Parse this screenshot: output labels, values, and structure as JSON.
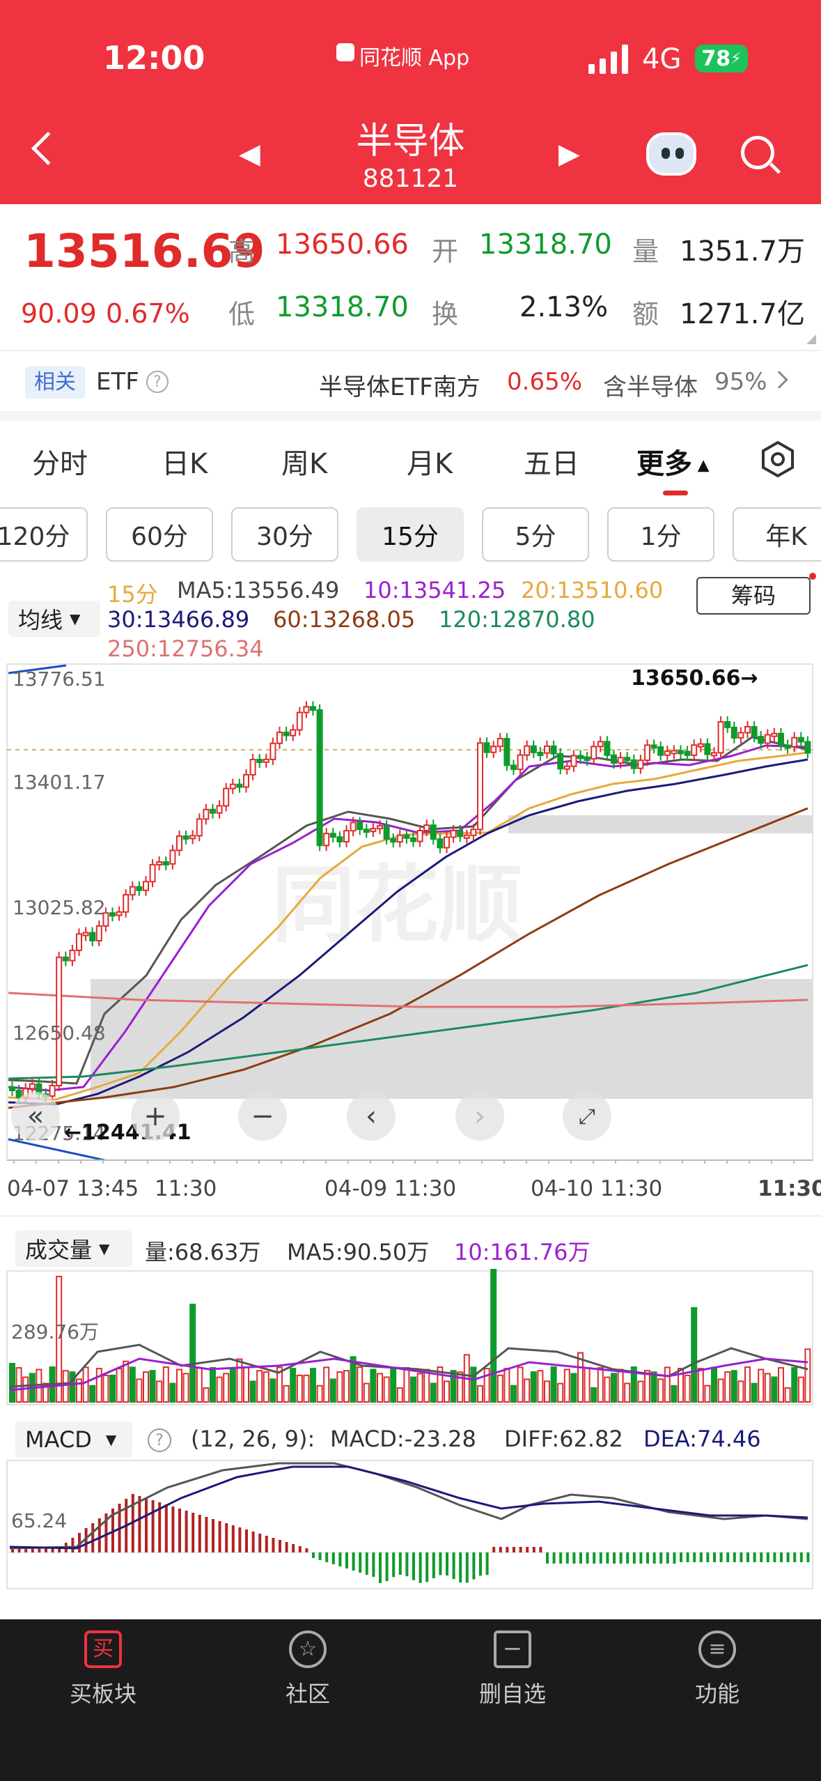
{
  "status_bar": {
    "time": "12:00",
    "app": "同花顺 App",
    "network": "4G",
    "battery": "78"
  },
  "header": {
    "title": "半导体",
    "code": "881121",
    "prev": "◀",
    "next": "▶"
  },
  "quote": {
    "price": "13516.69",
    "change": "90.09",
    "change_pct": "0.67%",
    "high_label": "高",
    "high": "13650.66",
    "open_label": "开",
    "open": "13318.70",
    "vol_label": "量",
    "vol": "1351.7万",
    "low_label": "低",
    "low": "13318.70",
    "turn_label": "换",
    "turn": "2.13%",
    "amt_label": "额",
    "amt": "1271.7亿"
  },
  "etf": {
    "tag": "相关",
    "label": "ETF",
    "name": "半导体ETF南方",
    "pct": "0.65%",
    "hold": "含半导体",
    "hold_pct": "95%"
  },
  "tabs": [
    "分时",
    "日K",
    "周K",
    "月K",
    "五日",
    "更多"
  ],
  "periods": [
    "120分",
    "60分",
    "30分",
    "15分",
    "5分",
    "1分",
    "年K"
  ],
  "ma": {
    "selector": "均线",
    "period": "15分",
    "ma5": "MA5:13556.49",
    "ma10": "10:13541.25",
    "ma20": "20:13510.60",
    "ma30": "30:13466.89",
    "ma60": "60:13268.05",
    "ma120": "120:12870.80",
    "ma250": "250:12756.34",
    "chip": "筹码"
  },
  "kline_axis": {
    "y": [
      "13776.51",
      "13401.17",
      "13025.82",
      "12650.48",
      "12275.14"
    ],
    "x": [
      "04-07 13:45",
      "11:30",
      "04-09 11:30",
      "04-10 11:30",
      "11:30"
    ],
    "max_marker": "13650.66→",
    "min_marker": "←12441.41"
  },
  "volume": {
    "selector": "成交量",
    "cur": "量:68.63万",
    "ma5": "MA5:90.50万",
    "ma10": "10:161.76万",
    "ylab": "289.76万"
  },
  "macd": {
    "selector": "MACD",
    "params": "(12, 26, 9):",
    "macd": "MACD:-23.28",
    "diff": "DIFF:62.82",
    "dea": "DEA:74.46",
    "ylab": "65.24"
  },
  "watermark": "同花顺",
  "bottom_nav": [
    "买板块",
    "社区",
    "删自选",
    "功能"
  ],
  "colors": {
    "brand": "#ef3340",
    "up": "#e02b2b",
    "down": "#0e9b2c"
  }
}
